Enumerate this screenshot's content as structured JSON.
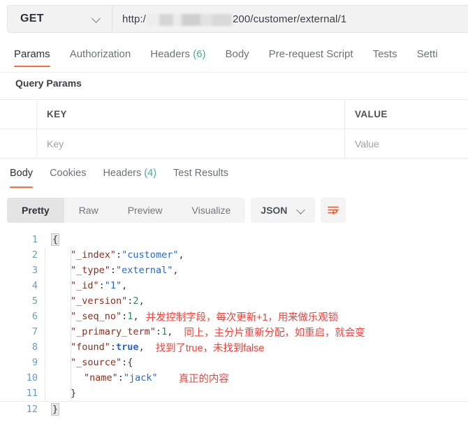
{
  "request": {
    "method": "GET",
    "method_icon": "chevron-down-icon",
    "url_prefix": "http:/",
    "url_redacted": true,
    "url_suffix": "200/customer/external/1",
    "tabs": [
      {
        "label": "Params",
        "active": true
      },
      {
        "label": "Authorization",
        "active": false
      },
      {
        "label": "Headers",
        "count": "(6)",
        "active": false
      },
      {
        "label": "Body",
        "active": false
      },
      {
        "label": "Pre-request Script",
        "active": false
      },
      {
        "label": "Tests",
        "active": false
      },
      {
        "label": "Setti",
        "active": false
      }
    ]
  },
  "query_params": {
    "title": "Query Params",
    "headers": {
      "check": "",
      "key": "KEY",
      "value": "VALUE"
    },
    "rows": [
      {
        "check": "",
        "key_placeholder": "Key",
        "value_placeholder": "Value"
      }
    ]
  },
  "response": {
    "tabs": [
      {
        "label": "Body",
        "active": true
      },
      {
        "label": "Cookies",
        "active": false
      },
      {
        "label": "Headers",
        "count": "(4)",
        "active": false
      },
      {
        "label": "Test Results",
        "active": false
      }
    ],
    "view_modes": [
      {
        "label": "Pretty",
        "active": true
      },
      {
        "label": "Raw",
        "active": false
      },
      {
        "label": "Preview",
        "active": false
      },
      {
        "label": "Visualize",
        "active": false
      }
    ],
    "format": {
      "label": "JSON",
      "icon": "chevron-down-icon"
    },
    "wrap_button": {
      "icon": "word-wrap-icon",
      "color": "#e8552b"
    }
  },
  "json_body": {
    "lines": [
      {
        "n": "1",
        "open_brace": "{"
      },
      {
        "n": "2",
        "key": "\"_index\"",
        "colon": ": ",
        "value": "\"customer\"",
        "vtype": "str",
        "comma": ","
      },
      {
        "n": "3",
        "key": "\"_type\"",
        "colon": ": ",
        "value": "\"external\"",
        "vtype": "str",
        "comma": ","
      },
      {
        "n": "4",
        "key": "\"_id\"",
        "colon": ": ",
        "value": "\"1\"",
        "vtype": "str",
        "comma": ","
      },
      {
        "n": "5",
        "key": "\"_version\"",
        "colon": ": ",
        "value": "2",
        "vtype": "num",
        "comma": ","
      },
      {
        "n": "6",
        "key": "\"_seq_no\"",
        "colon": ": ",
        "value": "1",
        "vtype": "num",
        "comma": ",",
        "note": "并发控制字段，每次更新+1，用来做乐观锁"
      },
      {
        "n": "7",
        "key": "\"_primary_term\"",
        "colon": ": ",
        "value": "1",
        "vtype": "num",
        "comma": ",",
        "note": "同上，主分片重新分配，如重启，就会变"
      },
      {
        "n": "8",
        "key": "\"found\"",
        "colon": ": ",
        "value": "true",
        "vtype": "bool",
        "comma": ",",
        "note": "找到了true，未找到false"
      },
      {
        "n": "9",
        "key": "\"_source\"",
        "colon": ": ",
        "value": "{",
        "vtype": "brace",
        "comma": ""
      },
      {
        "n": "10",
        "key": "\"name\"",
        "colon": ": ",
        "value": "\"jack\"",
        "vtype": "str",
        "comma": "",
        "note": "真正的内容"
      },
      {
        "n": "11",
        "close_brace": "}"
      },
      {
        "n": "12",
        "close_brace": "}"
      }
    ]
  },
  "colors": {
    "accent": "#ff6c37",
    "note": "#f4423b",
    "json_key": "#8b2e20",
    "json_string": "#2b66c9",
    "json_number": "#2e8b57",
    "line_number": "#6a9dbd",
    "count_green": "#4aae8c"
  }
}
